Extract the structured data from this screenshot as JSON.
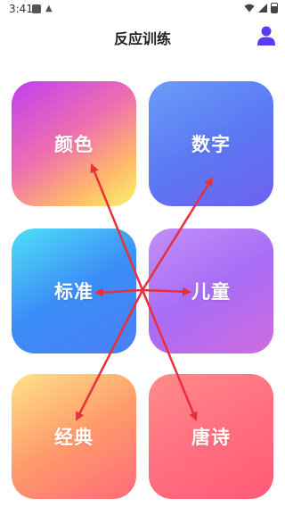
{
  "status": {
    "time": "3:41"
  },
  "appbar": {
    "title": "反应训练",
    "profile_icon": "profile-icon"
  },
  "modes": [
    {
      "label": "颜色"
    },
    {
      "label": "数字"
    },
    {
      "label": "标准"
    },
    {
      "label": "儿童"
    },
    {
      "label": "经典"
    },
    {
      "label": "唐诗"
    }
  ],
  "colors": {
    "accent": "#5b3cf0",
    "annotation_arrow": "#e8303a"
  }
}
